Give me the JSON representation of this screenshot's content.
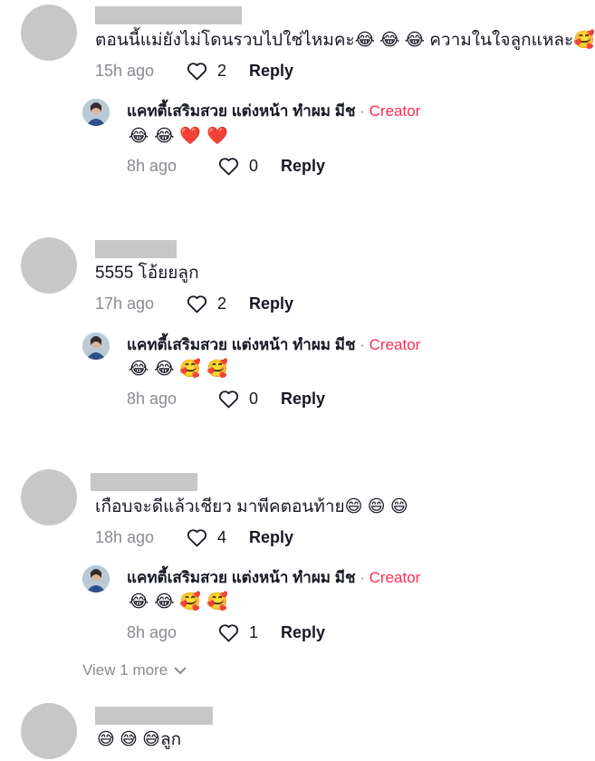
{
  "comments": [
    {
      "text": "ตอนนี้แม่ยังไม่โดนรวบไปใช่ไหมคะ😂 😂 😂 ความในใจลูกแหละ🥰",
      "time": "15h ago",
      "likes": "2",
      "reply_label": "Reply",
      "creator_reply": {
        "name": "แคทตี้เสริมสวย แต่งหน้า ทำผม มีช",
        "separator": "·",
        "badge": "Creator",
        "emojis": [
          "😂",
          "😂",
          "❤️",
          "❤️"
        ],
        "time": "8h ago",
        "likes": "0",
        "reply_label": "Reply"
      }
    },
    {
      "text": "5555 โอ้ยยลูก",
      "time": "17h ago",
      "likes": "2",
      "reply_label": "Reply",
      "creator_reply": {
        "name": "แคทตี้เสริมสวย แต่งหน้า ทำผม มีช",
        "separator": "·",
        "badge": "Creator",
        "emojis": [
          "😂",
          "😂",
          "🥰",
          "🥰"
        ],
        "time": "8h ago",
        "likes": "0",
        "reply_label": "Reply"
      }
    },
    {
      "text": "เกือบจะดีแล้วเชียว มาพีคตอนท้าย😄 😄 😄",
      "time": "18h ago",
      "likes": "4",
      "reply_label": "Reply",
      "creator_reply": {
        "name": "แคทตี้เสริมสวย แต่งหน้า ทำผม มีช",
        "separator": "·",
        "badge": "Creator",
        "emojis": [
          "😂",
          "😂",
          "🥰",
          "🥰"
        ],
        "time": "8h ago",
        "likes": "1",
        "reply_label": "Reply"
      },
      "view_more": "View 1 more"
    },
    {
      "text": "😅 😅 😅ลูก"
    }
  ],
  "colors": {
    "creator_badge": "#fe2c55",
    "muted": "#8a8b91",
    "placeholder": "#c7c7c7"
  }
}
